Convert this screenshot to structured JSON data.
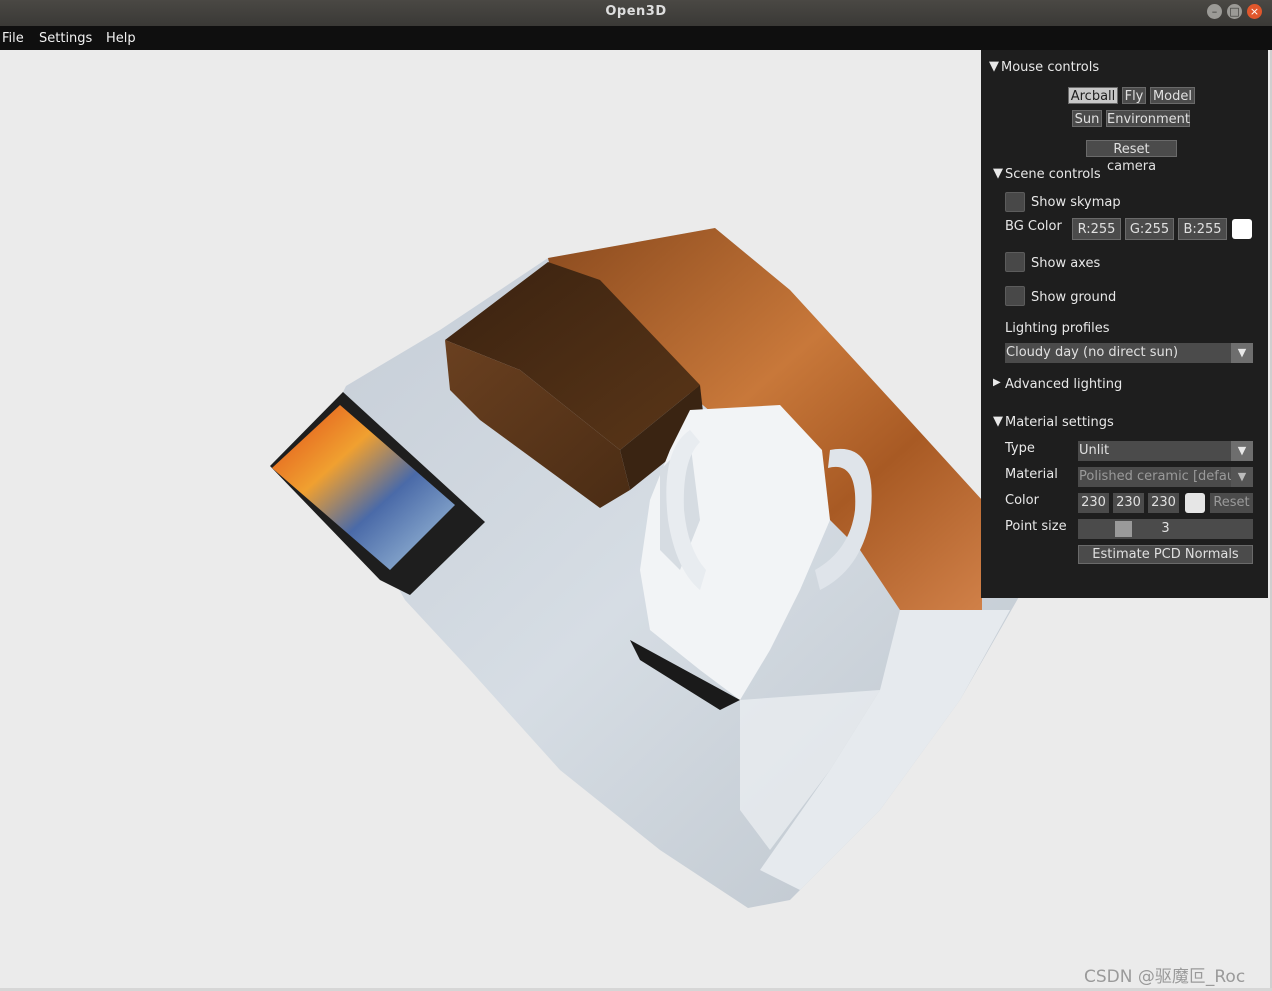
{
  "window": {
    "title": "Open3D"
  },
  "menu": [
    "File",
    "Settings",
    "Help"
  ],
  "panel": {
    "mouse_controls": {
      "header": "Mouse controls",
      "buttons": [
        "Arcball",
        "Fly",
        "Model",
        "Sun",
        "Environment"
      ],
      "selected": "Arcball",
      "reset_camera": "Reset camera"
    },
    "scene_controls": {
      "header": "Scene controls",
      "show_skymap": "Show skymap",
      "bg_color_label": "BG Color",
      "bg_r": "R:255",
      "bg_g": "G:255",
      "bg_b": "B:255",
      "bg_swatch_color": "#ffffff",
      "show_axes": "Show axes",
      "show_ground": "Show ground",
      "lighting_profiles_label": "Lighting profiles",
      "lighting_profile_value": "Cloudy day (no direct sun)",
      "advanced_lighting": "Advanced lighting"
    },
    "material_settings": {
      "header": "Material settings",
      "type_label": "Type",
      "type_value": "Unlit",
      "material_label": "Material",
      "material_value": "Polished ceramic [default]",
      "color_label": "Color",
      "color_r": "230",
      "color_g": "230",
      "color_b": "230",
      "color_swatch": "#e6e6e6",
      "reset": "Reset",
      "point_size_label": "Point size",
      "point_size_value": "3",
      "estimate_normals": "Estimate PCD Normals"
    }
  },
  "watermark": "CSDN @驱魔叵_Roc"
}
